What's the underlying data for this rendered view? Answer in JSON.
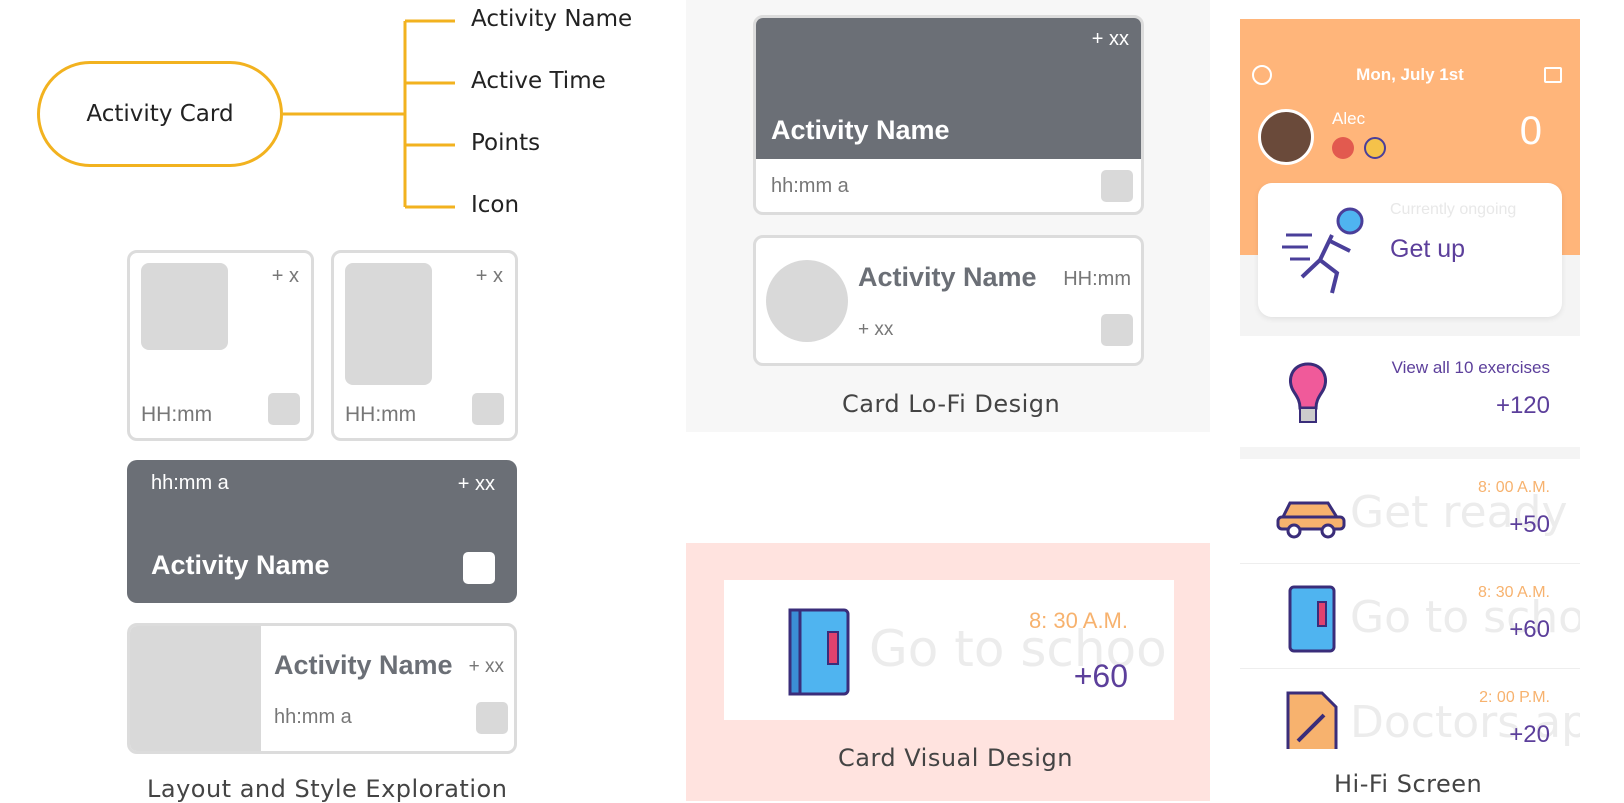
{
  "mindmap": {
    "center": "Activity Card",
    "branches": [
      "Activity Name",
      "Active Time",
      "Points",
      "Icon"
    ]
  },
  "exploration": {
    "small_cards": [
      {
        "points": "+ x",
        "time": "HH:mm"
      },
      {
        "points": "+ x",
        "time": "HH:mm"
      }
    ],
    "dark_card": {
      "time": "hh:mm a",
      "points": "+ xx",
      "name": "Activity Name"
    },
    "split_card": {
      "name": "Activity Name",
      "points": "+ xx",
      "time": "hh:mm a"
    },
    "caption": "Layout and Style Exploration"
  },
  "lofi": {
    "card1": {
      "points": "+ xx",
      "name": "Activity Name",
      "time": "hh:mm a"
    },
    "card2": {
      "name": "Activity Name",
      "time": "HH:mm",
      "points": "+ xx"
    },
    "caption": "Card Lo-Fi Design"
  },
  "visual": {
    "time": "8: 30 A.M.",
    "points": "+60",
    "ghost": "Go to school",
    "caption": "Card Visual Design"
  },
  "hifi": {
    "date": "Mon, July 1st",
    "user": "Alec",
    "score": "0",
    "ongoing": {
      "label": "Currently ongoing",
      "name": "Get up"
    },
    "exercises": {
      "label": "View all 10 exercises",
      "points": "+120"
    },
    "items": [
      {
        "time": "8: 00 A.M.",
        "points": "+50",
        "ghost": "Get ready",
        "icon": "car-icon"
      },
      {
        "time": "8: 30 A.M.",
        "points": "+60",
        "ghost": "Go to school",
        "icon": "book-icon"
      },
      {
        "time": "2: 00 P.M.",
        "points": "+20",
        "ghost": "Doctors appointment",
        "icon": "document-icon"
      }
    ],
    "caption": "Hi-Fi Screen"
  },
  "colors": {
    "accent_yellow": "#f2b21f",
    "wire_gray": "#6b6f76",
    "orange": "#ffb57a",
    "purple": "#5c3f9b",
    "visual_bg": "#ffe3df"
  }
}
